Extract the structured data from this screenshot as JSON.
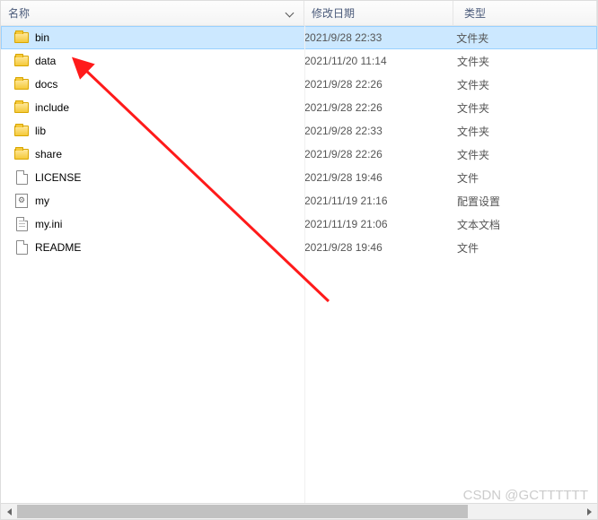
{
  "header": {
    "name": "名称",
    "date": "修改日期",
    "type": "类型"
  },
  "rows": [
    {
      "icon": "folder",
      "name": "bin",
      "date": "2021/9/28 22:33",
      "type": "文件夹",
      "selected": true
    },
    {
      "icon": "folder",
      "name": "data",
      "date": "2021/11/20 11:14",
      "type": "文件夹"
    },
    {
      "icon": "folder",
      "name": "docs",
      "date": "2021/9/28 22:26",
      "type": "文件夹"
    },
    {
      "icon": "folder",
      "name": "include",
      "date": "2021/9/28 22:26",
      "type": "文件夹"
    },
    {
      "icon": "folder",
      "name": "lib",
      "date": "2021/9/28 22:33",
      "type": "文件夹"
    },
    {
      "icon": "folder",
      "name": "share",
      "date": "2021/9/28 22:26",
      "type": "文件夹"
    },
    {
      "icon": "doc",
      "name": "LICENSE",
      "date": "2021/9/28 19:46",
      "type": "文件"
    },
    {
      "icon": "cfg",
      "name": "my",
      "date": "2021/11/19 21:16",
      "type": "配置设置"
    },
    {
      "icon": "txt",
      "name": "my.ini",
      "date": "2021/11/19 21:06",
      "type": "文本文档"
    },
    {
      "icon": "doc",
      "name": "README",
      "date": "2021/9/28 19:46",
      "type": "文件"
    }
  ],
  "watermark": "CSDN @GCTTTTTT"
}
